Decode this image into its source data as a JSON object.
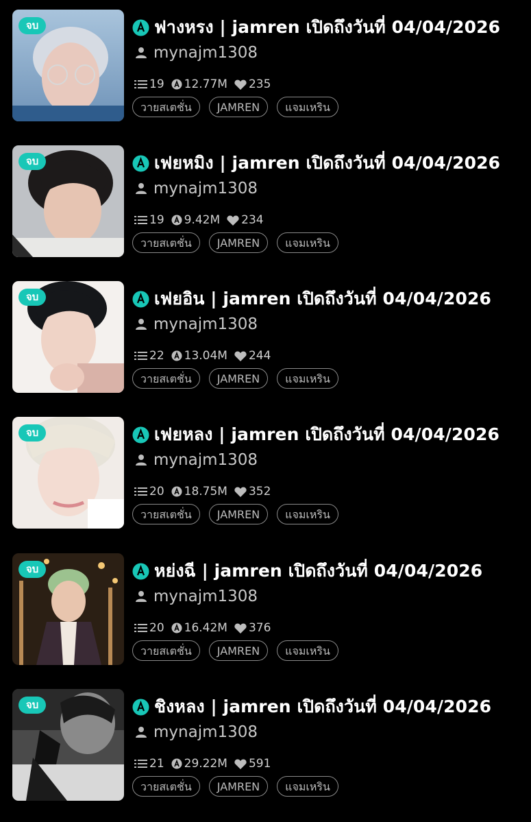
{
  "accent": "#18c7b7",
  "items": [
    {
      "badge": "จบ",
      "title": "ฟางหรง | jamren เปิดถึงวันที่ 04/04/2026",
      "author": "mynajm1308",
      "chapters": "19",
      "views": "12.77M",
      "likes": "235",
      "tags": [
        "วายสเตชั่น",
        "JAMREN",
        "แจมเหริน"
      ]
    },
    {
      "badge": "จบ",
      "title": "เฟยหมิง | jamren เปิดถึงวันที่ 04/04/2026",
      "author": "mynajm1308",
      "chapters": "19",
      "views": "9.42M",
      "likes": "234",
      "tags": [
        "วายสเตชั่น",
        "JAMREN",
        "แจมเหริน"
      ]
    },
    {
      "badge": "จบ",
      "title": "เฟยอิน | jamren เปิดถึงวันที่ 04/04/2026",
      "author": "mynajm1308",
      "chapters": "22",
      "views": "13.04M",
      "likes": "244",
      "tags": [
        "วายสเตชั่น",
        "JAMREN",
        "แจมเหริน"
      ]
    },
    {
      "badge": "จบ",
      "title": "เฟยหลง | jamren เปิดถึงวันที่ 04/04/2026",
      "author": "mynajm1308",
      "chapters": "20",
      "views": "18.75M",
      "likes": "352",
      "tags": [
        "วายสเตชั่น",
        "JAMREN",
        "แจมเหริน"
      ]
    },
    {
      "badge": "จบ",
      "title": "หย่งฉี | jamren เปิดถึงวันที่ 04/04/2026",
      "author": "mynajm1308",
      "chapters": "20",
      "views": "16.42M",
      "likes": "376",
      "tags": [
        "วายสเตชั่น",
        "JAMREN",
        "แจมเหริน"
      ]
    },
    {
      "badge": "จบ",
      "title": "ชิงหลง | jamren เปิดถึงวันที่ 04/04/2026",
      "author": "mynajm1308",
      "chapters": "21",
      "views": "29.22M",
      "likes": "591",
      "tags": [
        "วายสเตชั่น",
        "JAMREN",
        "แจมเหริน"
      ]
    }
  ]
}
